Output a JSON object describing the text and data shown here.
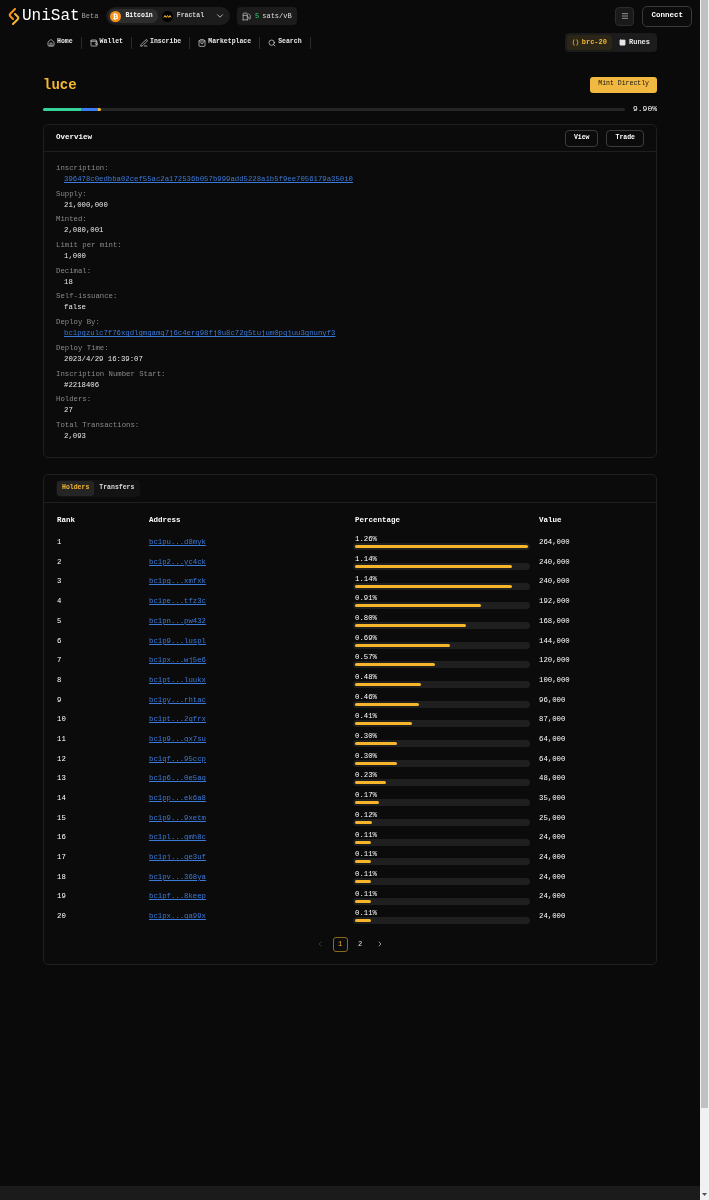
{
  "header": {
    "logo": {
      "name": "UniSat",
      "badge": "Beta"
    },
    "networks": [
      {
        "label": "Bitcoin",
        "selected": true
      },
      {
        "label": "Fractal",
        "selected": false
      }
    ],
    "fee": {
      "value": "5",
      "unit": "sats/vB"
    },
    "connect_button": "Connect"
  },
  "nav": {
    "items": [
      {
        "label": "Home"
      },
      {
        "label": "Wallet"
      },
      {
        "label": "Inscribe"
      },
      {
        "label": "Marketplace"
      },
      {
        "label": "Search"
      }
    ],
    "protocols": [
      {
        "label": "brc-20",
        "selected": true
      },
      {
        "label": "Runes",
        "selected": false
      }
    ]
  },
  "token": {
    "name": "luce",
    "mint_button": "Mint Directly",
    "progress": {
      "level": 0.099,
      "reading": "9.90%"
    }
  },
  "overview": {
    "title": "Overview",
    "buttons": [
      "View",
      "Trade"
    ],
    "fields": [
      {
        "label": "inscription:",
        "value": "396478c0edbba02cef55ac2a172536b057b999add5228a1b5f9ee7056179a350i0",
        "kind": "link"
      },
      {
        "label": "Supply:",
        "value": "21,000,000",
        "kind": "text"
      },
      {
        "label": "Minted:",
        "value": "2,080,001",
        "kind": "text"
      },
      {
        "label": "Limit per mint:",
        "value": "1,000",
        "kind": "text"
      },
      {
        "label": "Decimal:",
        "value": "18",
        "kind": "text"
      },
      {
        "label": "Self-issuance:",
        "value": "false",
        "kind": "text"
      },
      {
        "label": "Deploy By:",
        "value": "bc1pgzulc7f76xgdlgmgamq7j6c4erq98fj0u8c72g5tujum0pqjuu3gnunyf3",
        "kind": "link"
      },
      {
        "label": "Deploy Time:",
        "value": "2023/4/29 16:39:07",
        "kind": "text"
      },
      {
        "label": "Inscription Number Start:",
        "value": "#2218406",
        "kind": "text"
      },
      {
        "label": "Holders:",
        "value": "27",
        "kind": "text"
      },
      {
        "label": "Total Transactions:",
        "value": "2,093",
        "kind": "text"
      }
    ]
  },
  "holders": {
    "tabs": [
      {
        "label": "Holders",
        "selected": true
      },
      {
        "label": "Transfers",
        "selected": false
      }
    ],
    "columns": [
      "Rank",
      "Address",
      "Percentage",
      "Value"
    ],
    "rows": [
      {
        "rank": "1",
        "address": "bc1pu...d8myk",
        "percentage": "1.26%",
        "level": 1,
        "value": "264,000"
      },
      {
        "rank": "2",
        "address": "bc1p2...yc4ck",
        "percentage": "1.14%",
        "level": 0.91,
        "value": "240,000"
      },
      {
        "rank": "3",
        "address": "bc1pg...xmfxk",
        "percentage": "1.14%",
        "level": 0.91,
        "value": "240,000"
      },
      {
        "rank": "4",
        "address": "bc1pe...tfz3c",
        "percentage": "0.91%",
        "level": 0.73,
        "value": "192,000"
      },
      {
        "rank": "5",
        "address": "bc1pn...pw432",
        "percentage": "0.80%",
        "level": 0.64,
        "value": "168,000"
      },
      {
        "rank": "6",
        "address": "bc1p9...luspl",
        "percentage": "0.69%",
        "level": 0.55,
        "value": "144,000"
      },
      {
        "rank": "7",
        "address": "bc1px...wj5e6",
        "percentage": "0.57%",
        "level": 0.46,
        "value": "120,000"
      },
      {
        "rank": "8",
        "address": "bc1pt...luukx",
        "percentage": "0.48%",
        "level": 0.38,
        "value": "100,000"
      },
      {
        "rank": "9",
        "address": "bc1py...rhtac",
        "percentage": "0.46%",
        "level": 0.37,
        "value": "96,000"
      },
      {
        "rank": "10",
        "address": "bc1pt...2qfrx",
        "percentage": "0.41%",
        "level": 0.33,
        "value": "87,000"
      },
      {
        "rank": "11",
        "address": "bc1p9...gx7su",
        "percentage": "0.30%",
        "level": 0.24,
        "value": "64,000"
      },
      {
        "rank": "12",
        "address": "bc1qf...95ccp",
        "percentage": "0.30%",
        "level": 0.24,
        "value": "64,000"
      },
      {
        "rank": "13",
        "address": "bc1p6...0e5aq",
        "percentage": "0.23%",
        "level": 0.18,
        "value": "48,000"
      },
      {
        "rank": "14",
        "address": "bc1pp...ek6a8",
        "percentage": "0.17%",
        "level": 0.14,
        "value": "35,000"
      },
      {
        "rank": "15",
        "address": "bc1p9...9xetm",
        "percentage": "0.12%",
        "level": 0.1,
        "value": "25,000"
      },
      {
        "rank": "16",
        "address": "bc1pl...gmh8c",
        "percentage": "0.11%",
        "level": 0.09,
        "value": "24,000"
      },
      {
        "rank": "17",
        "address": "bc1pj...qe3uf",
        "percentage": "0.11%",
        "level": 0.09,
        "value": "24,000"
      },
      {
        "rank": "18",
        "address": "bc1pv...368ya",
        "percentage": "0.11%",
        "level": 0.09,
        "value": "24,000"
      },
      {
        "rank": "19",
        "address": "bc1pf...8keep",
        "percentage": "0.11%",
        "level": 0.09,
        "value": "24,000"
      },
      {
        "rank": "20",
        "address": "bc1px...qa99x",
        "percentage": "0.11%",
        "level": 0.09,
        "value": "24,000"
      }
    ],
    "pagination": {
      "prev": {
        "disabled": true
      },
      "pages": [
        {
          "label": "1",
          "selected": true
        },
        {
          "label": "2",
          "selected": false
        }
      ],
      "next": {
        "disabled": false
      }
    }
  }
}
